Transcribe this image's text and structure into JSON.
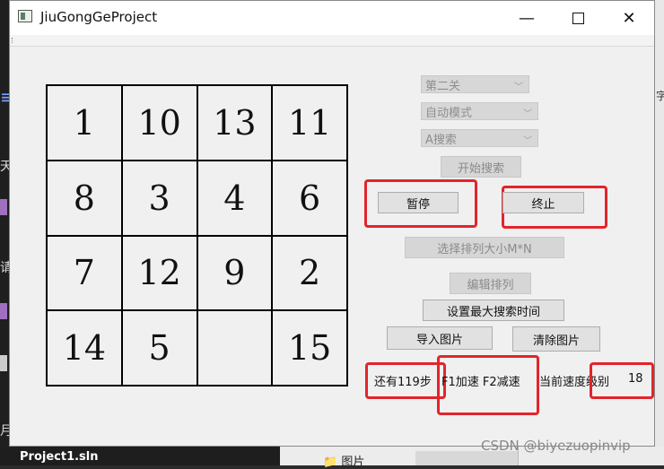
{
  "window": {
    "title": "JiuGongGeProject",
    "minimize_glyph": "—",
    "close_glyph": "✕"
  },
  "puzzle": {
    "tiles": [
      [
        "1",
        "10",
        "13",
        "11"
      ],
      [
        "8",
        "3",
        "4",
        "6"
      ],
      [
        "7",
        "12",
        "9",
        "2"
      ],
      [
        "14",
        "5",
        "",
        "15"
      ]
    ]
  },
  "controls": {
    "level_select": {
      "selected": "第二关"
    },
    "mode_select": {
      "selected": "自动模式"
    },
    "algo_select": {
      "selected": "A搜索"
    },
    "start_search": "开始搜索",
    "pause": "暂停",
    "stop": "终止",
    "choose_size": "选择排列大小M*N",
    "edit_arrangement": "编辑排列",
    "set_max_time": "设置最大搜索时间",
    "import_image": "导入图片",
    "clear_image": "清除图片"
  },
  "status": {
    "steps_left": "还有119步",
    "speed_keys": "F1加速 F2减速",
    "speed_label": "当前速度级别",
    "speed_level": "18"
  },
  "background": {
    "taskbar_label": "Project1.sln",
    "folder_label": "图片",
    "watermark": "CSDN @biyezuopinvip"
  },
  "colors": {
    "highlight": "#e3242b",
    "window_bg": "#f0f0f0",
    "disabled_text": "#8a8a8a"
  }
}
